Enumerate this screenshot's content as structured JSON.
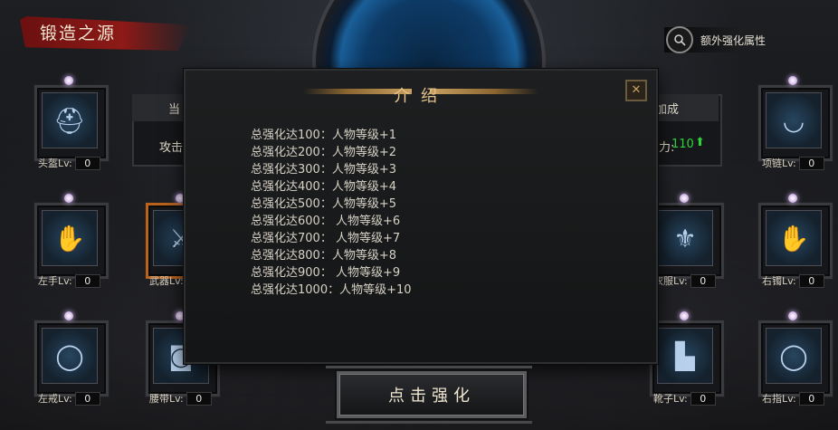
{
  "header": {
    "title": "锻造之源",
    "extra_attr_label": "额外强化属性"
  },
  "slots": {
    "helmet": {
      "label": "头盔Lv:",
      "level": "0"
    },
    "left_hand": {
      "label": "左手Lv:",
      "level": "0"
    },
    "weapon": {
      "label": "武器Lv:",
      "level": "0"
    },
    "left_ring": {
      "label": "左戒Lv:",
      "level": "0"
    },
    "belt": {
      "label": "腰带Lv:",
      "level": "0"
    },
    "necklace": {
      "label": "项链Lv:",
      "level": "0"
    },
    "clothes": {
      "label": "衣服Lv:",
      "level": "0"
    },
    "right_hand": {
      "label": "右镯Lv:",
      "level": "0"
    },
    "boots": {
      "label": "靴子Lv:",
      "level": "0"
    },
    "right_ring": {
      "label": "右指Lv:",
      "level": "0"
    }
  },
  "left_panel": {
    "head": "当",
    "body": "攻击"
  },
  "right_panel": {
    "head": "加成",
    "colon": "力:",
    "value": "110",
    "arrow": "⬆"
  },
  "modal": {
    "title": "介绍",
    "close": "✕",
    "rules": [
      "总强化达100：人物等级+1",
      "总强化达200：人物等级+2",
      "总强化达300：人物等级+3",
      "总强化达400：人物等级+4",
      "总强化达500：人物等级+5",
      "总强化达600： 人物等级+6",
      "总强化达700： 人物等级+7",
      "总强化达800：人物等级+8",
      "总强化达900： 人物等级+9",
      "总强化达1000：人物等级+10"
    ]
  },
  "action": {
    "strengthen_label": "点击强化"
  },
  "colors": {
    "accent_gold": "#e4c38b",
    "power_green": "#2bd63a",
    "banner_red": "#8d1a17"
  }
}
